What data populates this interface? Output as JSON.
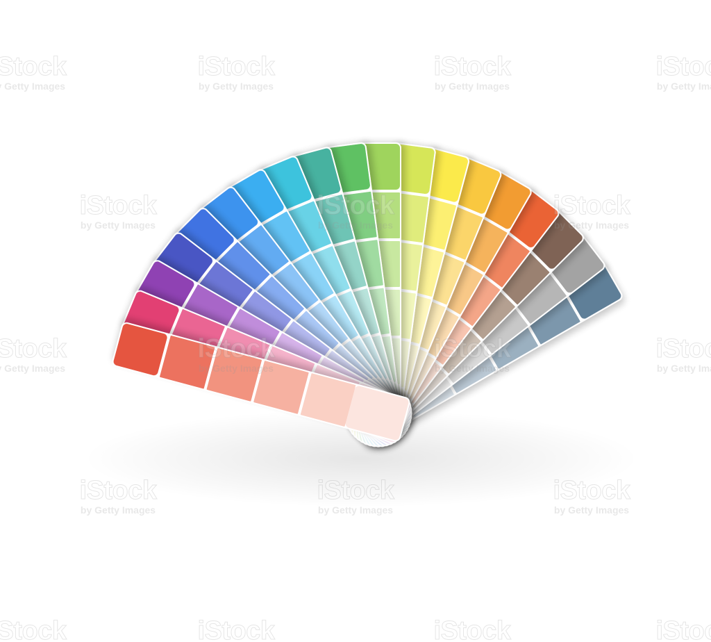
{
  "watermark": {
    "logo": "iStock",
    "sub": "by Getty Images"
  },
  "fan": {
    "cards": [
      {
        "name": "coral-red",
        "shades": [
          "#e5553f",
          "#ec725f",
          "#f2937f",
          "#f6b1a1",
          "#fad0c4"
        ]
      },
      {
        "name": "pink",
        "shades": [
          "#e23f73",
          "#ea6593",
          "#f08db0",
          "#f5b3cb",
          "#fad3e1"
        ]
      },
      {
        "name": "purple",
        "shades": [
          "#8f43b3",
          "#a866c8",
          "#c08ddb",
          "#d6b3ea",
          "#e9d6f4"
        ]
      },
      {
        "name": "indigo",
        "shades": [
          "#4a56c4",
          "#6c76d6",
          "#9097e4",
          "#b4b9ef",
          "#d5d8f7"
        ]
      },
      {
        "name": "royal-blue",
        "shades": [
          "#3f73e2",
          "#6190ea",
          "#86acf1",
          "#aac8f6",
          "#d0e1fb"
        ]
      },
      {
        "name": "sky-blue",
        "shades": [
          "#3d93ee",
          "#62abf2",
          "#8bc3f6",
          "#b2d8f9",
          "#d6ebfc"
        ]
      },
      {
        "name": "azure",
        "shades": [
          "#3aaef1",
          "#62c2f4",
          "#8ad3f7",
          "#b1e3fa",
          "#d5f1fc"
        ]
      },
      {
        "name": "cyan",
        "shades": [
          "#3ec3dd",
          "#68d2e6",
          "#90deed",
          "#b6eaf3",
          "#d8f4f9"
        ]
      },
      {
        "name": "teal",
        "shades": [
          "#47b2a0",
          "#6ec4b5",
          "#94d4c8",
          "#b8e3db",
          "#d9f1ec"
        ]
      },
      {
        "name": "green",
        "shades": [
          "#5fc163",
          "#80ce82",
          "#a0dba1",
          "#c0e8c0",
          "#def4dd"
        ]
      },
      {
        "name": "lime-green",
        "shades": [
          "#9fd45d",
          "#b4de7f",
          "#c8e8a0",
          "#dbf0c0",
          "#edf8de"
        ]
      },
      {
        "name": "yellow-green",
        "shades": [
          "#d6e659",
          "#e0ec7b",
          "#e9f19c",
          "#f1f6bc",
          "#f8fadb"
        ]
      },
      {
        "name": "yellow",
        "shades": [
          "#fbea4c",
          "#fcef72",
          "#fdf398",
          "#fef7bd",
          "#fffbdd"
        ]
      },
      {
        "name": "golden-yellow",
        "shades": [
          "#f9c840",
          "#fbd56a",
          "#fce192",
          "#fdebb9",
          "#fef5dc"
        ]
      },
      {
        "name": "orange",
        "shades": [
          "#f29c30",
          "#f5b35c",
          "#f8c887",
          "#fbdcb1",
          "#fdeed9"
        ]
      },
      {
        "name": "red-orange",
        "shades": [
          "#ea6435",
          "#ef855f",
          "#f4a688",
          "#f8c5b1",
          "#fce3d8"
        ]
      },
      {
        "name": "brown",
        "shades": [
          "#7f6454",
          "#9a8171",
          "#b4a091",
          "#cdc0b4",
          "#e5ddd6"
        ]
      },
      {
        "name": "gray",
        "shades": [
          "#a3a3a3",
          "#b6b6b6",
          "#c8c8c8",
          "#dadada",
          "#ececec"
        ]
      },
      {
        "name": "slate-blue",
        "shades": [
          "#5e7f98",
          "#7c97ac",
          "#9bb0c0",
          "#bac8d4",
          "#d9e2ea"
        ]
      }
    ]
  }
}
